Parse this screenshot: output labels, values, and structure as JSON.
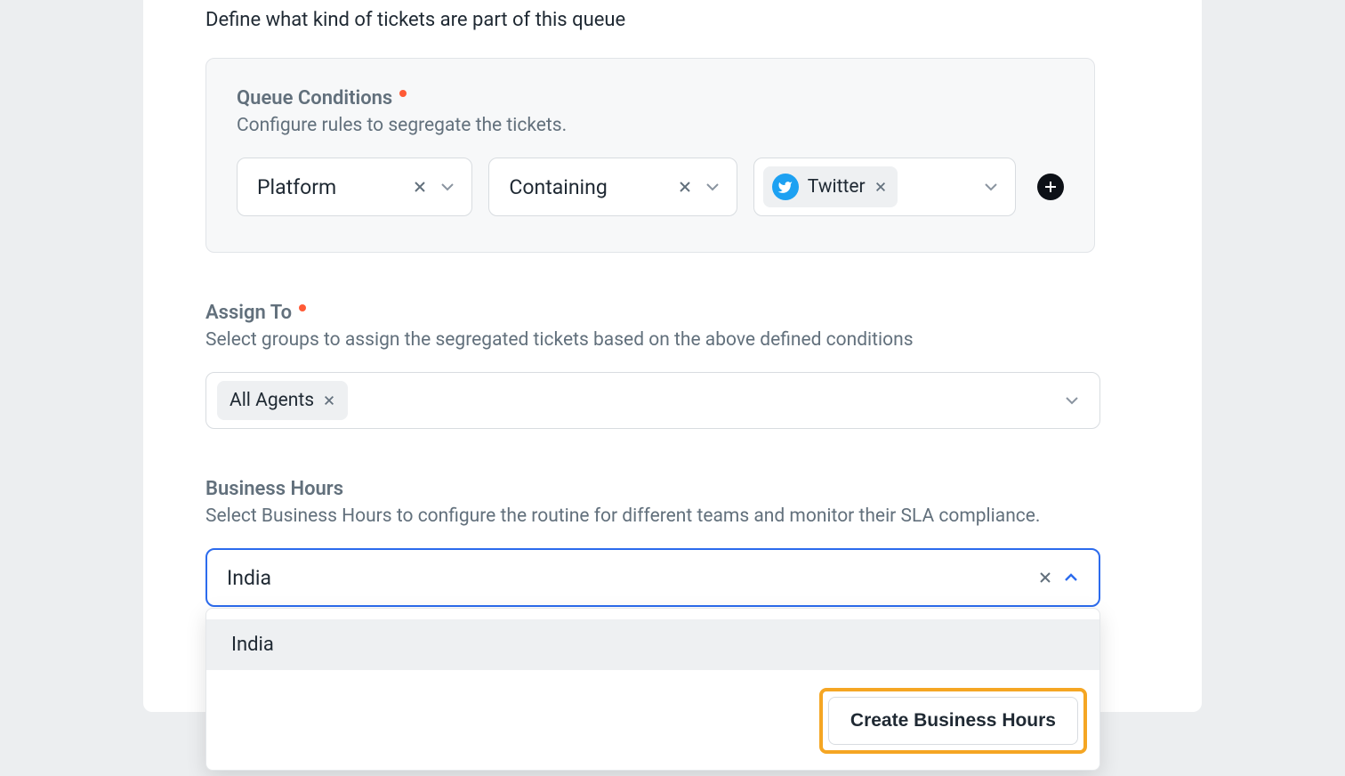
{
  "header": {
    "description": "Define what kind of tickets are part of this queue"
  },
  "conditions": {
    "label": "Queue Conditions",
    "help": "Configure rules to segregate the tickets.",
    "field_select": "Platform",
    "operator_select": "Containing",
    "value_chip": "Twitter"
  },
  "assign": {
    "label": "Assign To",
    "help": "Select groups to assign the segregated tickets based on the above defined conditions",
    "chip": "All Agents"
  },
  "business_hours": {
    "label": "Business Hours",
    "help": "Select Business Hours to configure the routine for different teams and monitor their SLA compliance.",
    "selected": "India",
    "option0": "India",
    "create_button": "Create Business Hours"
  }
}
